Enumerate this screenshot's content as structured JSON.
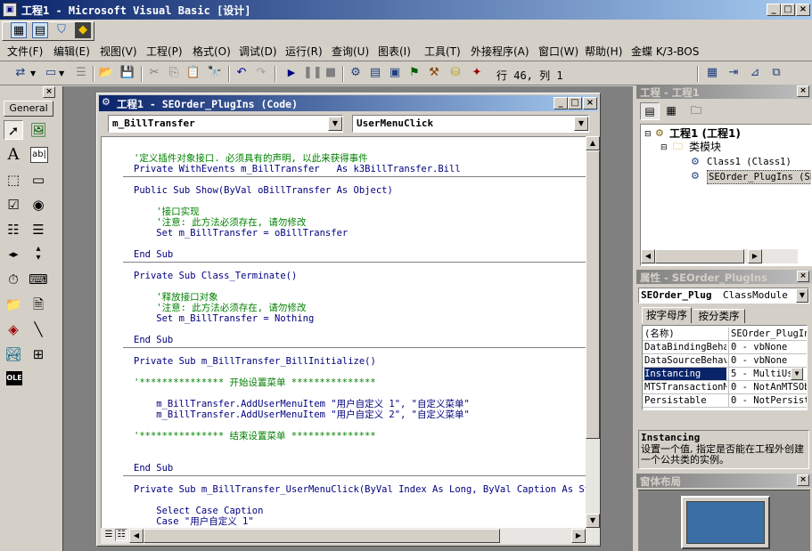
{
  "app": {
    "title": "工程1 - Microsoft Visual Basic [设计]"
  },
  "menubar": {
    "items": [
      "文件(F)",
      "编辑(E)",
      "视图(V)",
      "工程(P)",
      "格式(O)",
      "调试(D)",
      "运行(R)",
      "查询(U)",
      "图表(I)",
      "工具(T)",
      "外接程序(A)",
      "窗口(W)",
      "帮助(H)",
      "金蝶 K/3-BOS"
    ]
  },
  "toolbar": {
    "position_text": "行 46, 列 1"
  },
  "toolbox": {
    "tab_label": "General"
  },
  "code_window": {
    "title": "工程1 - SEOrder_PlugIns (Code)",
    "object_combo": "m_BillTransfer",
    "proc_combo": "UserMenuClick"
  },
  "code": {
    "l1": "'定义插件对象接口. 必须具有的声明, 以此来获得事件",
    "l2": "Private WithEvents m_BillTransfer   As k3BillTransfer.Bill",
    "l3": "Public Sub Show(ByVal oBillTransfer As Object)",
    "l4": "    '接口实现",
    "l5": "    '注意: 此方法必须存在, 请勿修改",
    "l6": "    Set m_BillTransfer = oBillTransfer",
    "l7": "End Sub",
    "l8": "Private Sub Class_Terminate()",
    "l9": "    '释放接口对象",
    "l10": "    '注意: 此方法必须存在, 请勿修改",
    "l11": "    Set m_BillTransfer = Nothing",
    "l12": "End Sub",
    "l13": "Private Sub m_BillTransfer_BillInitialize()",
    "l14": "'*************** 开始设置菜单 ***************",
    "l15": "    m_BillTransfer.AddUserMenuItem \"用户自定义 1\", \"自定义菜单\"",
    "l16": "    m_BillTransfer.AddUserMenuItem \"用户自定义 2\", \"自定义菜单\"",
    "l17": "'*************** 结束设置菜单 ***************",
    "l18": "End Sub",
    "l19": "Private Sub m_BillTransfer_UserMenuClick(ByVal Index As Long, ByVal Caption As String",
    "l20": "    Select Case Caption",
    "l21": "    Case \"用户自定义 1\""
  },
  "project_panel": {
    "title": "工程 - 工程1",
    "root": "工程1 (工程1)",
    "folder": "类模块",
    "class1": "Class1 (Class1)",
    "class2": "SEOrder_PlugIns (SE"
  },
  "props_panel": {
    "title": "属性 - SEOrder_PlugIns",
    "object_name": "SEOrder_Plug",
    "object_type": "ClassModule",
    "tab_alpha": "按字母序",
    "tab_cat": "按分类序",
    "rows": [
      {
        "name": "(名称)",
        "value": "SEOrder_PlugIn"
      },
      {
        "name": "DataBindingBehav",
        "value": "0 - vbNone"
      },
      {
        "name": "DataSourceBehav",
        "value": "0 - vbNone"
      },
      {
        "name": "Instancing",
        "value": "5 - MultiUs"
      },
      {
        "name": "MTSTransactionM",
        "value": "0 - NotAnMTSOb"
      },
      {
        "name": "Persistable",
        "value": "0 - NotPersist"
      }
    ],
    "desc_title": "Instancing",
    "desc_text": "设置一个值, 指定是否能在工程外创建一个公共类的实例。"
  },
  "layout_panel": {
    "title": "窗体布局"
  },
  "colors": {
    "title_active": "#0a246a",
    "mdi_bg": "#808080",
    "keyword": "#000080",
    "comment": "#008000",
    "selection": "#0a246a",
    "monitor_screen": "#3a6ea5"
  }
}
